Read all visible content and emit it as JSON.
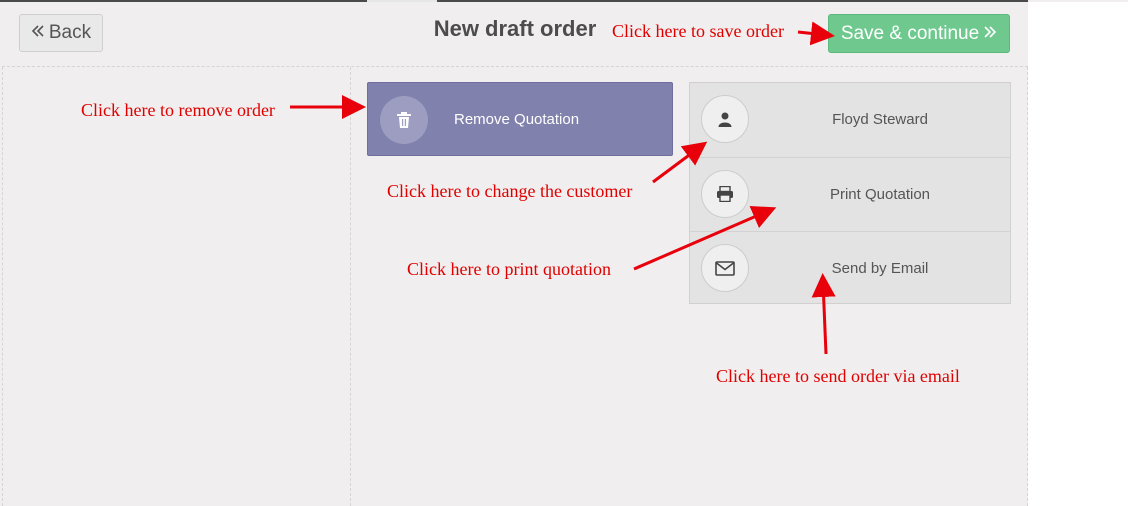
{
  "header": {
    "back_label": "Back",
    "back_icon": "double-chevron-left-icon",
    "title": "New draft order",
    "save_label": "Save & continue",
    "save_icon": "double-chevron-right-icon"
  },
  "actions": {
    "remove": {
      "label": "Remove Quotation",
      "icon": "trash-icon"
    },
    "customer": {
      "label": "Floyd Steward",
      "icon": "user-icon"
    },
    "print": {
      "label": "Print Quotation",
      "icon": "printer-icon"
    },
    "email": {
      "label": "Send by Email",
      "icon": "envelope-icon"
    }
  },
  "annotations": {
    "save": "Click here to save order",
    "remove": "Click here to remove order",
    "customer": "Click here to change the customer",
    "print": "Click here to print quotation",
    "email": "Click here to send order via email"
  },
  "colors": {
    "background": "#f0eeee",
    "save_button": "#6fc98f",
    "remove_button": "#8081ad",
    "annotation": "#e00000",
    "panel": "#e3e3e3"
  }
}
